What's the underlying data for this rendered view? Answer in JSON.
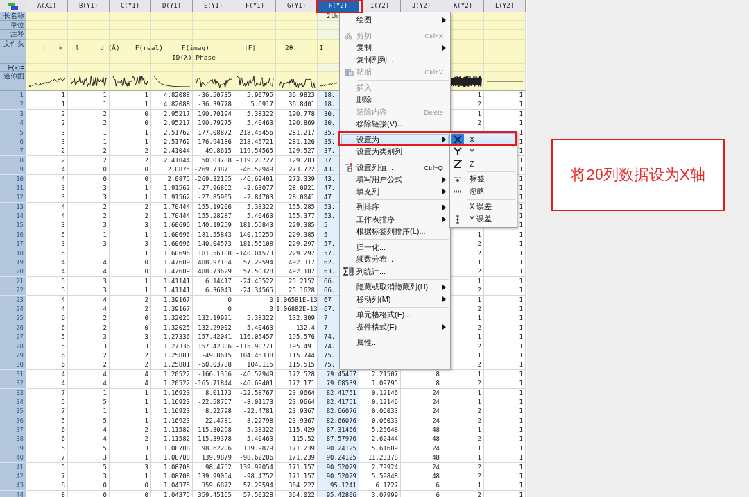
{
  "columns": [
    {
      "header": "A(X1)",
      "selected": false
    },
    {
      "header": "B(Y1)",
      "selected": false
    },
    {
      "header": "C(Y1)",
      "selected": false
    },
    {
      "header": "D(Y1)",
      "selected": false
    },
    {
      "header": "E(Y1)",
      "selected": false
    },
    {
      "header": "F(Y1)",
      "selected": false
    },
    {
      "header": "G(Y1)",
      "selected": false
    },
    {
      "header": "H(Y2)",
      "selected": true,
      "long_name": "2th"
    },
    {
      "header": "I(Y2)",
      "selected": false
    },
    {
      "header": "J(Y2)",
      "selected": false
    },
    {
      "header": "K(Y2)",
      "selected": false
    },
    {
      "header": "L(Y2)",
      "selected": false
    }
  ],
  "row_labels": [
    "长名称",
    "单位",
    "注释",
    "文件头",
    "F(x)=",
    "迷你图"
  ],
  "file_header": {
    "tokens": [
      "h",
      "k",
      "l",
      "d (Å)",
      "F(real)",
      "F(imag)",
      "|F|",
      "2θ",
      "I"
    ],
    "line2": "ID(λ) Phase"
  },
  "rows": [
    {
      "number": "1",
      "cells": [
        "1",
        "1",
        "1",
        "4.82088",
        "-36.50735",
        "5.90795",
        "36.9823",
        "18.",
        null,
        null,
        "1",
        "1"
      ]
    },
    {
      "number": "2",
      "cells": [
        "1",
        "1",
        "1",
        "4.82088",
        "-36.39778",
        "5.6917",
        "36.8401",
        "18.",
        null,
        null,
        "2",
        "1"
      ]
    },
    {
      "number": "3",
      "cells": [
        "2",
        "2",
        "0",
        "2.95217",
        "190.70194",
        "5.38322",
        "190.778",
        "30.",
        null,
        null,
        "1",
        "1"
      ]
    },
    {
      "number": "4",
      "cells": [
        "2",
        "2",
        "0",
        "2.95217",
        "190.79275",
        "5.40463",
        "190.869",
        "30.",
        null,
        null,
        "2",
        "1"
      ]
    },
    {
      "number": "5",
      "cells": [
        "3",
        "1",
        "1",
        "2.51762",
        "177.08872",
        "218.45456",
        "281.217",
        "35.",
        null,
        null,
        null,
        "1"
      ]
    },
    {
      "number": "6",
      "cells": [
        "3",
        "1",
        "1",
        "2.51762",
        "176.94186",
        "218.45721",
        "281.126",
        "35.",
        null,
        null,
        null,
        "1"
      ]
    },
    {
      "number": "7",
      "cells": [
        "2",
        "2",
        "2",
        "2.41044",
        "49.8615",
        "-119.54565",
        "129.527",
        "37.",
        null,
        null,
        null,
        "1"
      ]
    },
    {
      "number": "8",
      "cells": [
        "2",
        "2",
        "2",
        "2.41044",
        "50.03788",
        "-119.20727",
        "129.283",
        "37",
        null,
        null,
        null,
        "1"
      ]
    },
    {
      "number": "9",
      "cells": [
        "4",
        "0",
        "0",
        "2.0875",
        "-269.73871",
        "-46.52949",
        "273.722",
        "43.",
        null,
        null,
        null,
        "1"
      ]
    },
    {
      "number": "10",
      "cells": [
        "4",
        "0",
        "0",
        "2.0875",
        "-269.32155",
        "-46.69401",
        "273.339",
        "43.",
        null,
        null,
        null,
        "1"
      ]
    },
    {
      "number": "11",
      "cells": [
        "3",
        "3",
        "1",
        "1.91562",
        "-27.96862",
        "-2.63077",
        "28.0921",
        "47.",
        null,
        null,
        null,
        "1"
      ]
    },
    {
      "number": "12",
      "cells": [
        "3",
        "3",
        "1",
        "1.91562",
        "-27.85905",
        "-2.84703",
        "28.0041",
        "47",
        null,
        null,
        null,
        "1"
      ]
    },
    {
      "number": "13",
      "cells": [
        "4",
        "2",
        "2",
        "1.70444",
        "155.19206",
        "5.38322",
        "155.285",
        "53.",
        null,
        null,
        null,
        "1"
      ]
    },
    {
      "number": "14",
      "cells": [
        "4",
        "2",
        "2",
        "1.70444",
        "155.28287",
        "5.40463",
        "155.377",
        "53.",
        null,
        null,
        null,
        "1"
      ]
    },
    {
      "number": "15",
      "cells": [
        "3",
        "3",
        "3",
        "1.60696",
        "140.19259",
        "181.55843",
        "229.385",
        "5",
        null,
        null,
        null,
        "1"
      ]
    },
    {
      "number": "16",
      "cells": [
        "5",
        "1",
        "1",
        "1.60696",
        "181.55843",
        "-140.19259",
        "229.385",
        "5",
        null,
        null,
        "1",
        "1"
      ]
    },
    {
      "number": "17",
      "cells": [
        "3",
        "3",
        "3",
        "1.60696",
        "140.04573",
        "181.56108",
        "229.297",
        "57.",
        null,
        null,
        "2",
        "1"
      ]
    },
    {
      "number": "18",
      "cells": [
        "5",
        "1",
        "1",
        "1.60696",
        "181.56108",
        "-140.04573",
        "229.297",
        "57.",
        null,
        null,
        "2",
        "1"
      ]
    },
    {
      "number": "19",
      "cells": [
        "4",
        "4",
        "0",
        "1.47609",
        "488.97184",
        "57.29594",
        "492.317",
        "62.",
        null,
        null,
        "1",
        "1"
      ]
    },
    {
      "number": "20",
      "cells": [
        "4",
        "4",
        "0",
        "1.47609",
        "488.73629",
        "57.50328",
        "492.107",
        "63.",
        null,
        null,
        "2",
        "1"
      ]
    },
    {
      "number": "21",
      "cells": [
        "5",
        "3",
        "1",
        "1.41141",
        "6.14417",
        "-24.45522",
        "25.2152",
        "66.",
        null,
        null,
        "1",
        "1"
      ]
    },
    {
      "number": "22",
      "cells": [
        "5",
        "3",
        "1",
        "1.41141",
        "6.36043",
        "-24.34565",
        "25.1628",
        "66.",
        null,
        null,
        "2",
        "1"
      ]
    },
    {
      "number": "23",
      "cells": [
        "4",
        "4",
        "2",
        "1.39167",
        "0",
        "0",
        "1.06581E-13",
        "67",
        null,
        null,
        "1",
        "1"
      ]
    },
    {
      "number": "24",
      "cells": [
        "4",
        "4",
        "2",
        "1.39167",
        "0",
        "0",
        "1.06882E-13",
        "67.",
        null,
        null,
        "2",
        "1"
      ]
    },
    {
      "number": "25",
      "cells": [
        "6",
        "2",
        "0",
        "1.32025",
        "132.19921",
        "5.38322",
        "132.309",
        "7",
        null,
        null,
        "1",
        "1"
      ]
    },
    {
      "number": "26",
      "cells": [
        "6",
        "2",
        "0",
        "1.32025",
        "132.29002",
        "5.40463",
        "132.4",
        "7",
        null,
        null,
        "2",
        "1"
      ]
    },
    {
      "number": "27",
      "cells": [
        "5",
        "3",
        "3",
        "1.27336",
        "157.42041",
        "-116.05457",
        "195.576",
        "74.",
        null,
        null,
        "1",
        "1"
      ]
    },
    {
      "number": "28",
      "cells": [
        "5",
        "3",
        "3",
        "1.27336",
        "157.42306",
        "-115.90771",
        "195.491",
        "74.",
        null,
        null,
        "2",
        "1"
      ]
    },
    {
      "number": "29",
      "cells": [
        "6",
        "2",
        "2",
        "1.25881",
        "-49.8615",
        "104.45338",
        "115.744",
        "75.",
        null,
        null,
        "1",
        "1"
      ]
    },
    {
      "number": "30",
      "cells": [
        "6",
        "2",
        "2",
        "1.25881",
        "-50.03788",
        "104.115",
        "115.515",
        "75.",
        null,
        null,
        "2",
        "1"
      ]
    },
    {
      "number": "31",
      "cells": [
        "4",
        "4",
        "4",
        "1.20522",
        "-166.1356",
        "-46.52949",
        "172.528",
        "79.45457",
        "2.21507",
        "8",
        "1",
        "1"
      ]
    },
    {
      "number": "32",
      "cells": [
        "4",
        "4",
        "4",
        "1.20522",
        "-165.71844",
        "-46.69401",
        "172.171",
        "79.68539",
        "1.09795",
        "8",
        "2",
        "1"
      ]
    },
    {
      "number": "33",
      "cells": [
        "7",
        "1",
        "1",
        "1.16923",
        "8.01173",
        "-22.58767",
        "23.9664",
        "82.41751",
        "0.12146",
        "24",
        "1",
        "1"
      ]
    },
    {
      "number": "34",
      "cells": [
        "5",
        "5",
        "1",
        "1.16923",
        "-22.58767",
        "-8.01173",
        "23.9664",
        "82.41751",
        "0.12146",
        "24",
        "1",
        "1"
      ]
    },
    {
      "number": "35",
      "cells": [
        "7",
        "1",
        "1",
        "1.16923",
        "8.22798",
        "-22.4781",
        "23.9367",
        "82.66076",
        "0.06033",
        "24",
        "2",
        "1"
      ]
    },
    {
      "number": "36",
      "cells": [
        "5",
        "5",
        "1",
        "1.16923",
        "-22.4781",
        "-8.22798",
        "23.9367",
        "82.66076",
        "0.06033",
        "24",
        "2",
        "1"
      ]
    },
    {
      "number": "37",
      "cells": [
        "6",
        "4",
        "2",
        "1.11582",
        "115.30298",
        "5.38322",
        "115.429",
        "87.31466",
        "5.25648",
        "48",
        "1",
        "1"
      ]
    },
    {
      "number": "38",
      "cells": [
        "6",
        "4",
        "2",
        "1.11582",
        "115.39378",
        "5.40463",
        "115.52",
        "87.57976",
        "2.62444",
        "48",
        "2",
        "1"
      ]
    },
    {
      "number": "39",
      "cells": [
        "5",
        "5",
        "3",
        "1.08708",
        "98.62206",
        "139.9879",
        "171.239",
        "90.24125",
        "5.61689",
        "24",
        "1",
        "1"
      ]
    },
    {
      "number": "40",
      "cells": [
        "7",
        "3",
        "1",
        "1.08708",
        "139.9879",
        "-98.62206",
        "171.239",
        "90.24125",
        "11.23378",
        "48",
        "1",
        "1"
      ]
    },
    {
      "number": "41",
      "cells": [
        "5",
        "5",
        "3",
        "1.08708",
        "98.4752",
        "139.99054",
        "171.157",
        "90.52029",
        "2.79924",
        "24",
        "2",
        "1"
      ]
    },
    {
      "number": "42",
      "cells": [
        "7",
        "3",
        "1",
        "1.08708",
        "139.99054",
        "-98.4752",
        "171.157",
        "90.52029",
        "5.59848",
        "48",
        "2",
        "1"
      ]
    },
    {
      "number": "43",
      "cells": [
        "8",
        "0",
        "0",
        "1.04375",
        "359.6872",
        "57.29594",
        "364.222",
        "95.1241",
        "6.1727",
        "6",
        "1",
        "1"
      ]
    },
    {
      "number": "44",
      "cells": [
        "8",
        "0",
        "0",
        "1.04375",
        "359.45165",
        "57.50328",
        "364.022",
        "95.42806",
        "3.07999",
        "6",
        "2",
        "1"
      ]
    }
  ],
  "context_menu": {
    "items": [
      {
        "kind": "item",
        "label": "绘图",
        "submenu": true,
        "disabled": false,
        "selected": false
      },
      {
        "kind": "separator"
      },
      {
        "kind": "item",
        "label": "剪切",
        "shortcut": "Ctrl+X",
        "submenu": false,
        "disabled": true,
        "selected": false
      },
      {
        "kind": "item",
        "label": "复制",
        "submenu": true,
        "disabled": false,
        "selected": false
      },
      {
        "kind": "item",
        "label": "复制列到...",
        "submenu": false,
        "disabled": false,
        "selected": false
      },
      {
        "kind": "item",
        "label": "粘贴",
        "shortcut": "Ctrl+V",
        "submenu": false,
        "disabled": true,
        "selected": false
      },
      {
        "kind": "separator"
      },
      {
        "kind": "item",
        "label": "插入",
        "submenu": false,
        "disabled": true,
        "selected": false
      },
      {
        "kind": "item",
        "label": "删除",
        "submenu": false,
        "disabled": false,
        "selected": false
      },
      {
        "kind": "item",
        "label": "清除内容",
        "shortcut": "Delete",
        "submenu": false,
        "disabled": true,
        "selected": false
      },
      {
        "kind": "item",
        "label": "移除链接(V)...",
        "submenu": false,
        "disabled": false,
        "selected": false
      },
      {
        "kind": "separator"
      },
      {
        "kind": "item",
        "label": "设置为",
        "submenu": true,
        "disabled": false,
        "selected": true
      },
      {
        "kind": "item",
        "label": "设置为类别列",
        "submenu": false,
        "disabled": false,
        "selected": false
      },
      {
        "kind": "separator"
      },
      {
        "kind": "item",
        "label": "设置列值...",
        "shortcut": "Ctrl+Q",
        "submenu": false,
        "disabled": false,
        "selected": false
      },
      {
        "kind": "item",
        "label": "填写用户公式",
        "submenu": true,
        "disabled": false,
        "selected": false
      },
      {
        "kind": "item",
        "label": "填充列",
        "submenu": true,
        "disabled": false,
        "selected": false
      },
      {
        "kind": "separator"
      },
      {
        "kind": "item",
        "label": "列排序",
        "submenu": true,
        "disabled": false,
        "selected": false
      },
      {
        "kind": "item",
        "label": "工作表排序",
        "submenu": true,
        "disabled": false,
        "selected": false
      },
      {
        "kind": "item",
        "label": "根据标签列排序(L)...",
        "submenu": false,
        "disabled": false,
        "selected": false
      },
      {
        "kind": "separator"
      },
      {
        "kind": "item",
        "label": "归一化...",
        "submenu": false,
        "disabled": false,
        "selected": false
      },
      {
        "kind": "item",
        "label": "频数分布...",
        "submenu": false,
        "disabled": false,
        "selected": false
      },
      {
        "kind": "item",
        "label": "列统计...",
        "submenu": false,
        "disabled": false,
        "selected": false
      },
      {
        "kind": "separator"
      },
      {
        "kind": "item",
        "label": "隐藏或取消隐藏列(H)",
        "submenu": true,
        "disabled": false,
        "selected": false
      },
      {
        "kind": "item",
        "label": "移动列(M)",
        "submenu": true,
        "disabled": false,
        "selected": false
      },
      {
        "kind": "separator"
      },
      {
        "kind": "item",
        "label": "单元格格式(F)...",
        "submenu": false,
        "disabled": false,
        "selected": false
      },
      {
        "kind": "item",
        "label": "条件格式(F)",
        "submenu": true,
        "disabled": false,
        "selected": false
      },
      {
        "kind": "separator"
      },
      {
        "kind": "item",
        "label": "属性...",
        "submenu": false,
        "disabled": false,
        "selected": false
      }
    ]
  },
  "submenu": {
    "items": [
      {
        "kind": "item",
        "label": "X",
        "selected": true
      },
      {
        "kind": "item",
        "label": "Y",
        "selected": false
      },
      {
        "kind": "item",
        "label": "Z",
        "selected": false
      },
      {
        "kind": "separator"
      },
      {
        "kind": "item",
        "label": "标签",
        "selected": false
      },
      {
        "kind": "item",
        "label": "忽略",
        "selected": false
      },
      {
        "kind": "separator"
      },
      {
        "kind": "item",
        "label": "X 误差",
        "selected": false
      },
      {
        "kind": "item",
        "label": "Y 误差",
        "selected": false
      }
    ]
  },
  "annotation": "将2θ列数据设为X轴"
}
